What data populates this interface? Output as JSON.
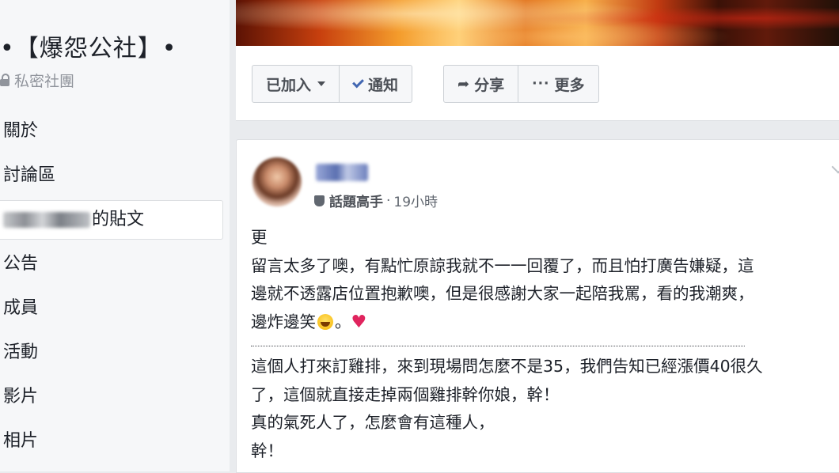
{
  "sidebar": {
    "group_name": "•【爆怨公社】•",
    "privacy": "私密社團",
    "nav": [
      {
        "label": "關於"
      },
      {
        "label": "討論區"
      },
      {
        "label": "的貼文",
        "active": true
      },
      {
        "label": "公告"
      },
      {
        "label": "成員"
      },
      {
        "label": "活動"
      },
      {
        "label": "影片"
      },
      {
        "label": "相片"
      }
    ]
  },
  "actions": {
    "joined": "已加入",
    "notify": "通知",
    "share": "分享",
    "more": "更多"
  },
  "post": {
    "badge": "話題高手",
    "separator": "·",
    "time": "19小時",
    "lines": [
      "更",
      "留言太多了噢，有點忙原諒我就不一一回覆了，而且怕打廣告嫌疑，這",
      "邊就不透露店位置抱歉噢，但是很感謝大家一起陪我罵，看的我潮爽，",
      "邊炸邊笑",
      "。"
    ],
    "story_lines": [
      "這個人打來訂雞排，來到現場問怎麼不是35，我們告知已經漲價40很久",
      "了，這個就直接走掉兩個雞排幹你娘，幹！",
      "真的氣死人了，怎麼會有這種人，",
      "幹！"
    ]
  },
  "colors": {
    "accent": "#4267b2",
    "heart": "#e0245e",
    "page_bg": "#e9ebee"
  },
  "icons": [
    "lock-icon",
    "caret-down-icon",
    "check-icon",
    "share-arrow-icon",
    "more-dots-icon",
    "badge-icon",
    "chevron-down-icon",
    "laughing-emoji-icon",
    "heart-icon"
  ]
}
